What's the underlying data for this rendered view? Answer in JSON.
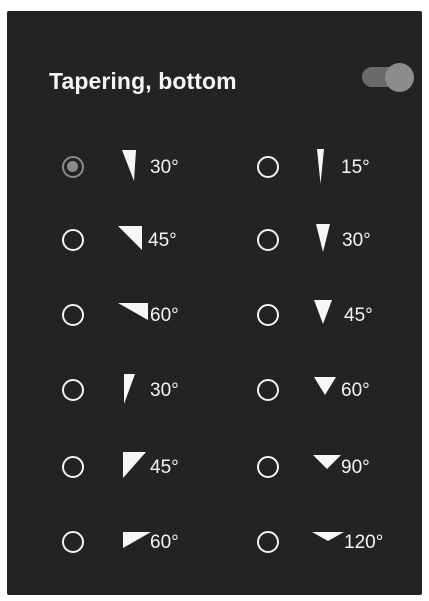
{
  "panel": {
    "title": "Tapering, bottom",
    "toggle": {
      "state": "on"
    }
  },
  "options": {
    "left": [
      {
        "label": "30°",
        "icon": "taper-30-vertical-icon",
        "selected": true
      },
      {
        "label": "45°",
        "icon": "taper-45-diagonal-icon",
        "selected": false
      },
      {
        "label": "60°",
        "icon": "taper-60-horizontal-icon",
        "selected": false
      },
      {
        "label": "30°",
        "icon": "taper-30-vertical-left-icon",
        "selected": false
      },
      {
        "label": "45°",
        "icon": "taper-45-diagonal-left-icon",
        "selected": false
      },
      {
        "label": "60°",
        "icon": "taper-60-horizontal-left-icon",
        "selected": false
      }
    ],
    "right": [
      {
        "label": "15°",
        "icon": "taper-15-symmetric-icon",
        "selected": false
      },
      {
        "label": "30°",
        "icon": "taper-30-symmetric-icon",
        "selected": false
      },
      {
        "label": "45°",
        "icon": "taper-45-symmetric-icon",
        "selected": false
      },
      {
        "label": "60°",
        "icon": "taper-60-symmetric-icon",
        "selected": false
      },
      {
        "label": "90°",
        "icon": "taper-90-symmetric-icon",
        "selected": false
      },
      {
        "label": "120°",
        "icon": "taper-120-symmetric-icon",
        "selected": false
      }
    ]
  },
  "colors": {
    "panel_background": "#232323",
    "text": "#f4f4f4",
    "selected_radio": "#8a8a8a"
  }
}
